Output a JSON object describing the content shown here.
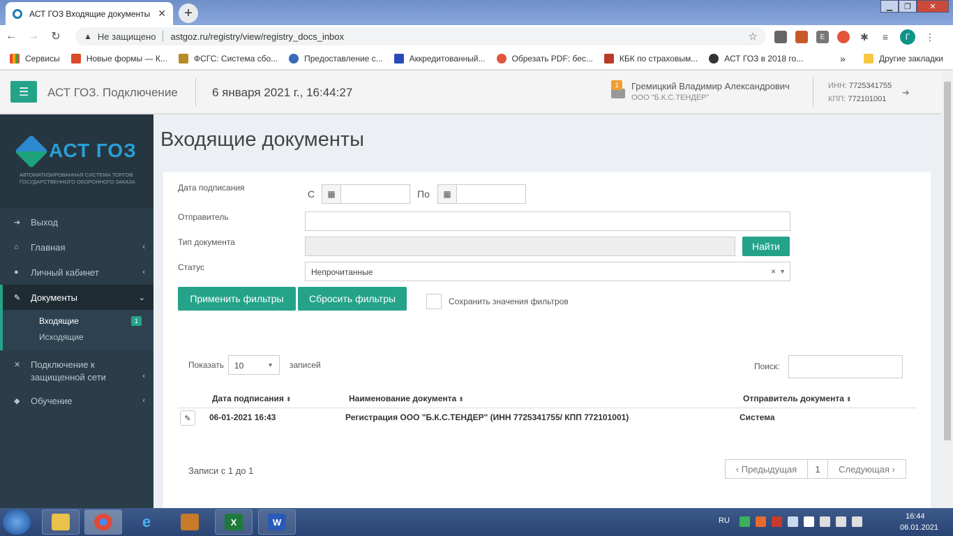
{
  "browser": {
    "tab_title": "АСТ ГОЗ Входящие документы",
    "tab_close": "✕",
    "new_tab": "+",
    "insecure_label": "Не защищено",
    "url": "astgoz.ru/registry/view/registry_docs_inbox",
    "profile_initial": "Г",
    "bookmarks": [
      "Сервисы",
      "Новые формы — К...",
      "ФСГС: Система сбо...",
      "Предоставление с...",
      "Аккредитованный...",
      "Обрезать PDF: бес...",
      "КБК по страховым...",
      "АСТ ГОЗ в 2018 го..."
    ],
    "bookmarks_more": "»",
    "other_bookmarks": "Другие закладки"
  },
  "header": {
    "app_title": "АСТ ГОЗ. Подключение",
    "datetime": "6 января 2021 г., 16:44:27",
    "notification_count": "1",
    "user_name": "Гремицкий Владимир Александрович",
    "user_org": "ООО \"Б.К.С.ТЕНДЕР\"",
    "inn_label": "ИНН:",
    "inn_value": "7725341755",
    "kpp_label": "КПП:",
    "kpp_value": "772101001"
  },
  "sidebar": {
    "logo_text": "АСТ ГОЗ",
    "logo_sub": "Автоматизированная система торгов государственного оборонного заказа",
    "items": [
      {
        "label": "Выход"
      },
      {
        "label": "Главная"
      },
      {
        "label": "Личный кабинет"
      },
      {
        "label": "Документы"
      },
      {
        "label": "Подключение к защищенной сети"
      },
      {
        "label": "Обучение"
      }
    ],
    "subitems": [
      {
        "label": "Входящие",
        "badge": "1"
      },
      {
        "label": "Исходящие"
      }
    ]
  },
  "main": {
    "page_title": "Входящие документы",
    "filters": {
      "date_label": "Дата подписания",
      "from_label": "С",
      "to_label": "По",
      "sender_label": "Отправитель",
      "doctype_label": "Тип документа",
      "status_label": "Статус",
      "status_value": "Непрочитанные",
      "status_clear": "×",
      "find_button": "Найти",
      "apply_button": "Применить фильтры",
      "reset_button": "Сбросить фильтры",
      "save_values_label": "Сохранить значения фильтров"
    },
    "table": {
      "show_label": "Показать",
      "page_size": "10",
      "records_label": "записей",
      "search_label": "Поиск:",
      "columns": [
        "Дата подписания",
        "Наименование документа",
        "Отправитель документа"
      ],
      "rows": [
        {
          "date": "06-01-2021 16:43",
          "name": "Регистрация ООО \"Б.К.С.ТЕНДЕР\" (ИНН 7725341755/ КПП 772101001)",
          "sender": "Система"
        }
      ],
      "info": "Записи с 1 до 1",
      "prev": "Предыдущая",
      "page": "1",
      "next": "Следующая"
    }
  },
  "taskbar": {
    "lang": "RU",
    "time": "16:44",
    "date": "06.01.2021"
  },
  "colors": {
    "accent": "#24a389",
    "sidebar_bg": "#2a3d49"
  }
}
